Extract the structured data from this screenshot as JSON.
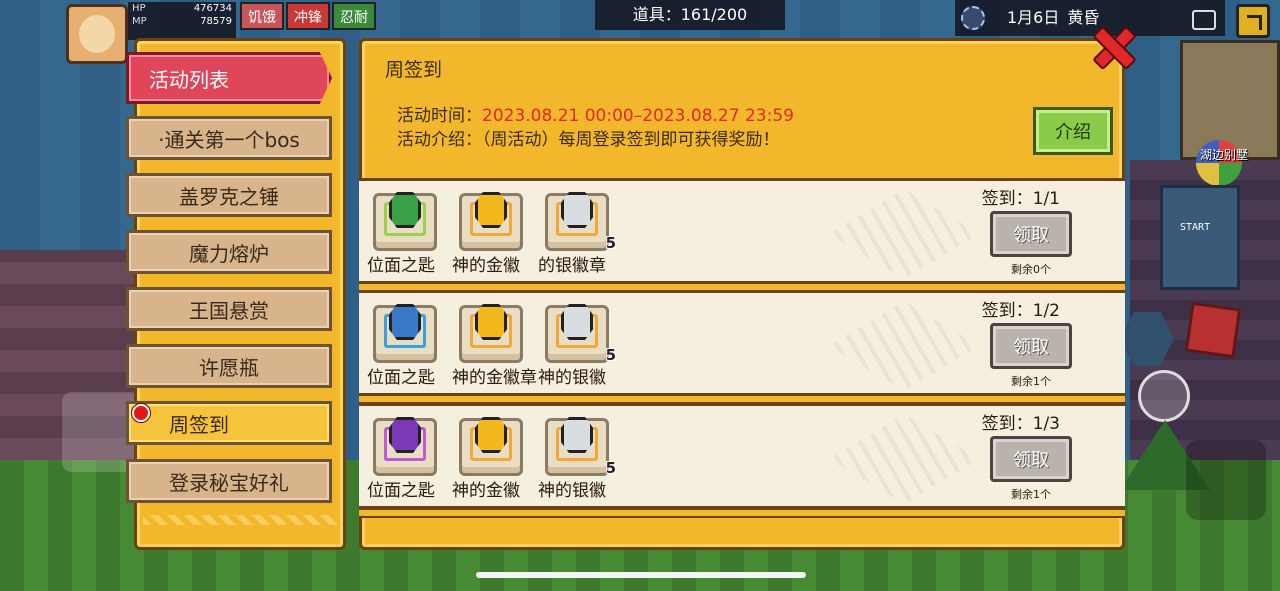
{
  "hud": {
    "hp_label": "HP",
    "hp_value": "476734",
    "mp_label": "MP",
    "mp_value": "78579",
    "status_tags": [
      "饥饿",
      "冲锋",
      "忍耐"
    ],
    "items_label": "道具：161/200",
    "date": "1月6日",
    "time_of_day": "黄昏"
  },
  "scene": {
    "house_label": "湖边别墅",
    "arcade_label": "START"
  },
  "menu": {
    "items": [
      {
        "label": "活动列表",
        "state": "header"
      },
      {
        "label": "·通关第一个bos",
        "state": "normal"
      },
      {
        "label": "盖罗克之锤",
        "state": "normal"
      },
      {
        "label": "魔力熔炉",
        "state": "normal"
      },
      {
        "label": "王国悬赏",
        "state": "normal"
      },
      {
        "label": "许愿瓶",
        "state": "normal"
      },
      {
        "label": "周签到",
        "state": "current"
      },
      {
        "label": "登录秘宝好礼",
        "state": "normal"
      }
    ]
  },
  "activity": {
    "title": "周签到",
    "time_label": "活动时间：",
    "time_value": "2023.08.21 00:00–2023.08.27 23:59",
    "intro_label": "活动介绍：",
    "intro_value": "（周活动）每周登录签到即可获得奖励！",
    "intro_button": "介绍"
  },
  "rewards": [
    {
      "items": [
        {
          "name": "位面之匙",
          "gem_color": "#3aa048",
          "frame_color": "#9ad04a",
          "count": ""
        },
        {
          "name": "神的金徽章",
          "gem_color": "#f2b81e",
          "frame_color": "#f0a83a",
          "count": ""
        },
        {
          "name": "神的银徽章",
          "gem_color": "#d8dde2",
          "frame_color": "#f0a83a",
          "count": "5"
        }
      ],
      "item_names_visible": [
        "位面之匙",
        "神的金徽",
        "的银徽章"
      ],
      "sign": "签到：1/1",
      "button": "领取",
      "remain": "剩余0个"
    },
    {
      "items": [
        {
          "name": "位面之匙",
          "gem_color": "#3a78c8",
          "frame_color": "#3aa0e0",
          "count": ""
        },
        {
          "name": "神的金徽章",
          "gem_color": "#f2b81e",
          "frame_color": "#f0a83a",
          "count": ""
        },
        {
          "name": "神的银徽章",
          "gem_color": "#d8dde2",
          "frame_color": "#f0a83a",
          "count": "5"
        }
      ],
      "item_names_visible": [
        "位面之匙",
        "神的金徽章",
        "神的银徽"
      ],
      "sign": "签到：1/2",
      "button": "领取",
      "remain": "剩余1个"
    },
    {
      "items": [
        {
          "name": "位面之匙",
          "gem_color": "#7a3ab8",
          "frame_color": "#c05ad0",
          "count": ""
        },
        {
          "name": "神的金徽章",
          "gem_color": "#f2b81e",
          "frame_color": "#f0a83a",
          "count": ""
        },
        {
          "name": "神的银徽章",
          "gem_color": "#d8dde2",
          "frame_color": "#f0a83a",
          "count": "5"
        }
      ],
      "item_names_visible": [
        "位面之匙",
        "神的金徽",
        "神的银徽"
      ],
      "sign": "签到：1/3",
      "button": "领取",
      "remain": "剩余1个"
    }
  ]
}
